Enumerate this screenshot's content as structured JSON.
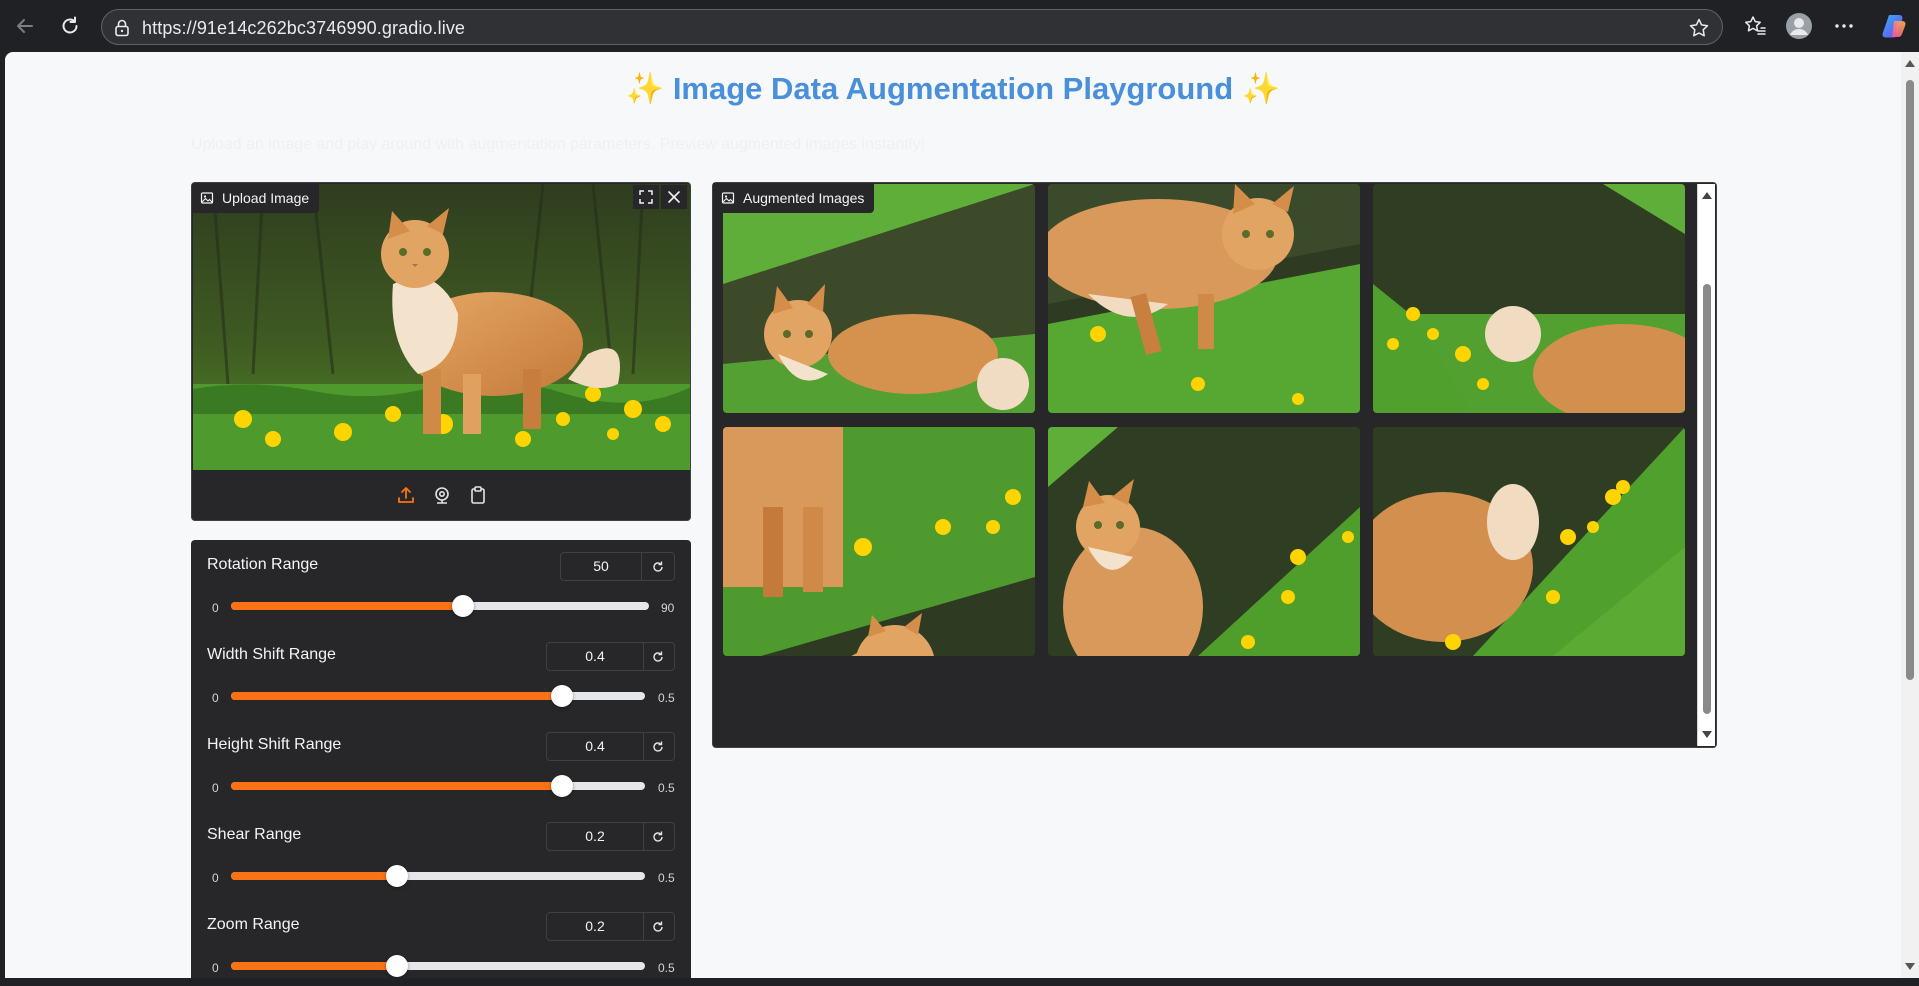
{
  "browser": {
    "url": "https://91e14c262bc3746990.gradio.live"
  },
  "page": {
    "title_text": "Image Data Augmentation Playground",
    "title_emoji": "✨",
    "subtitle": "Upload an image and play around with augmentation parameters. Preview augmented images instantly!"
  },
  "upload": {
    "label": "Upload Image"
  },
  "gallery": {
    "label": "Augmented Images"
  },
  "controls": [
    {
      "label": "Rotation Range",
      "value": "50",
      "min": "0",
      "max": "90",
      "fraction": 0.5556
    },
    {
      "label": "Width Shift Range",
      "value": "0.4",
      "min": "0",
      "max": "0.5",
      "fraction": 0.8
    },
    {
      "label": "Height Shift Range",
      "value": "0.4",
      "min": "0",
      "max": "0.5",
      "fraction": 0.8
    },
    {
      "label": "Shear Range",
      "value": "0.2",
      "min": "0",
      "max": "0.5",
      "fraction": 0.4
    },
    {
      "label": "Zoom Range",
      "value": "0.2",
      "min": "0",
      "max": "0.5",
      "fraction": 0.4
    }
  ],
  "colors": {
    "accent": "#f97316",
    "title": "#4a8fd9",
    "panel": "#27272a"
  }
}
